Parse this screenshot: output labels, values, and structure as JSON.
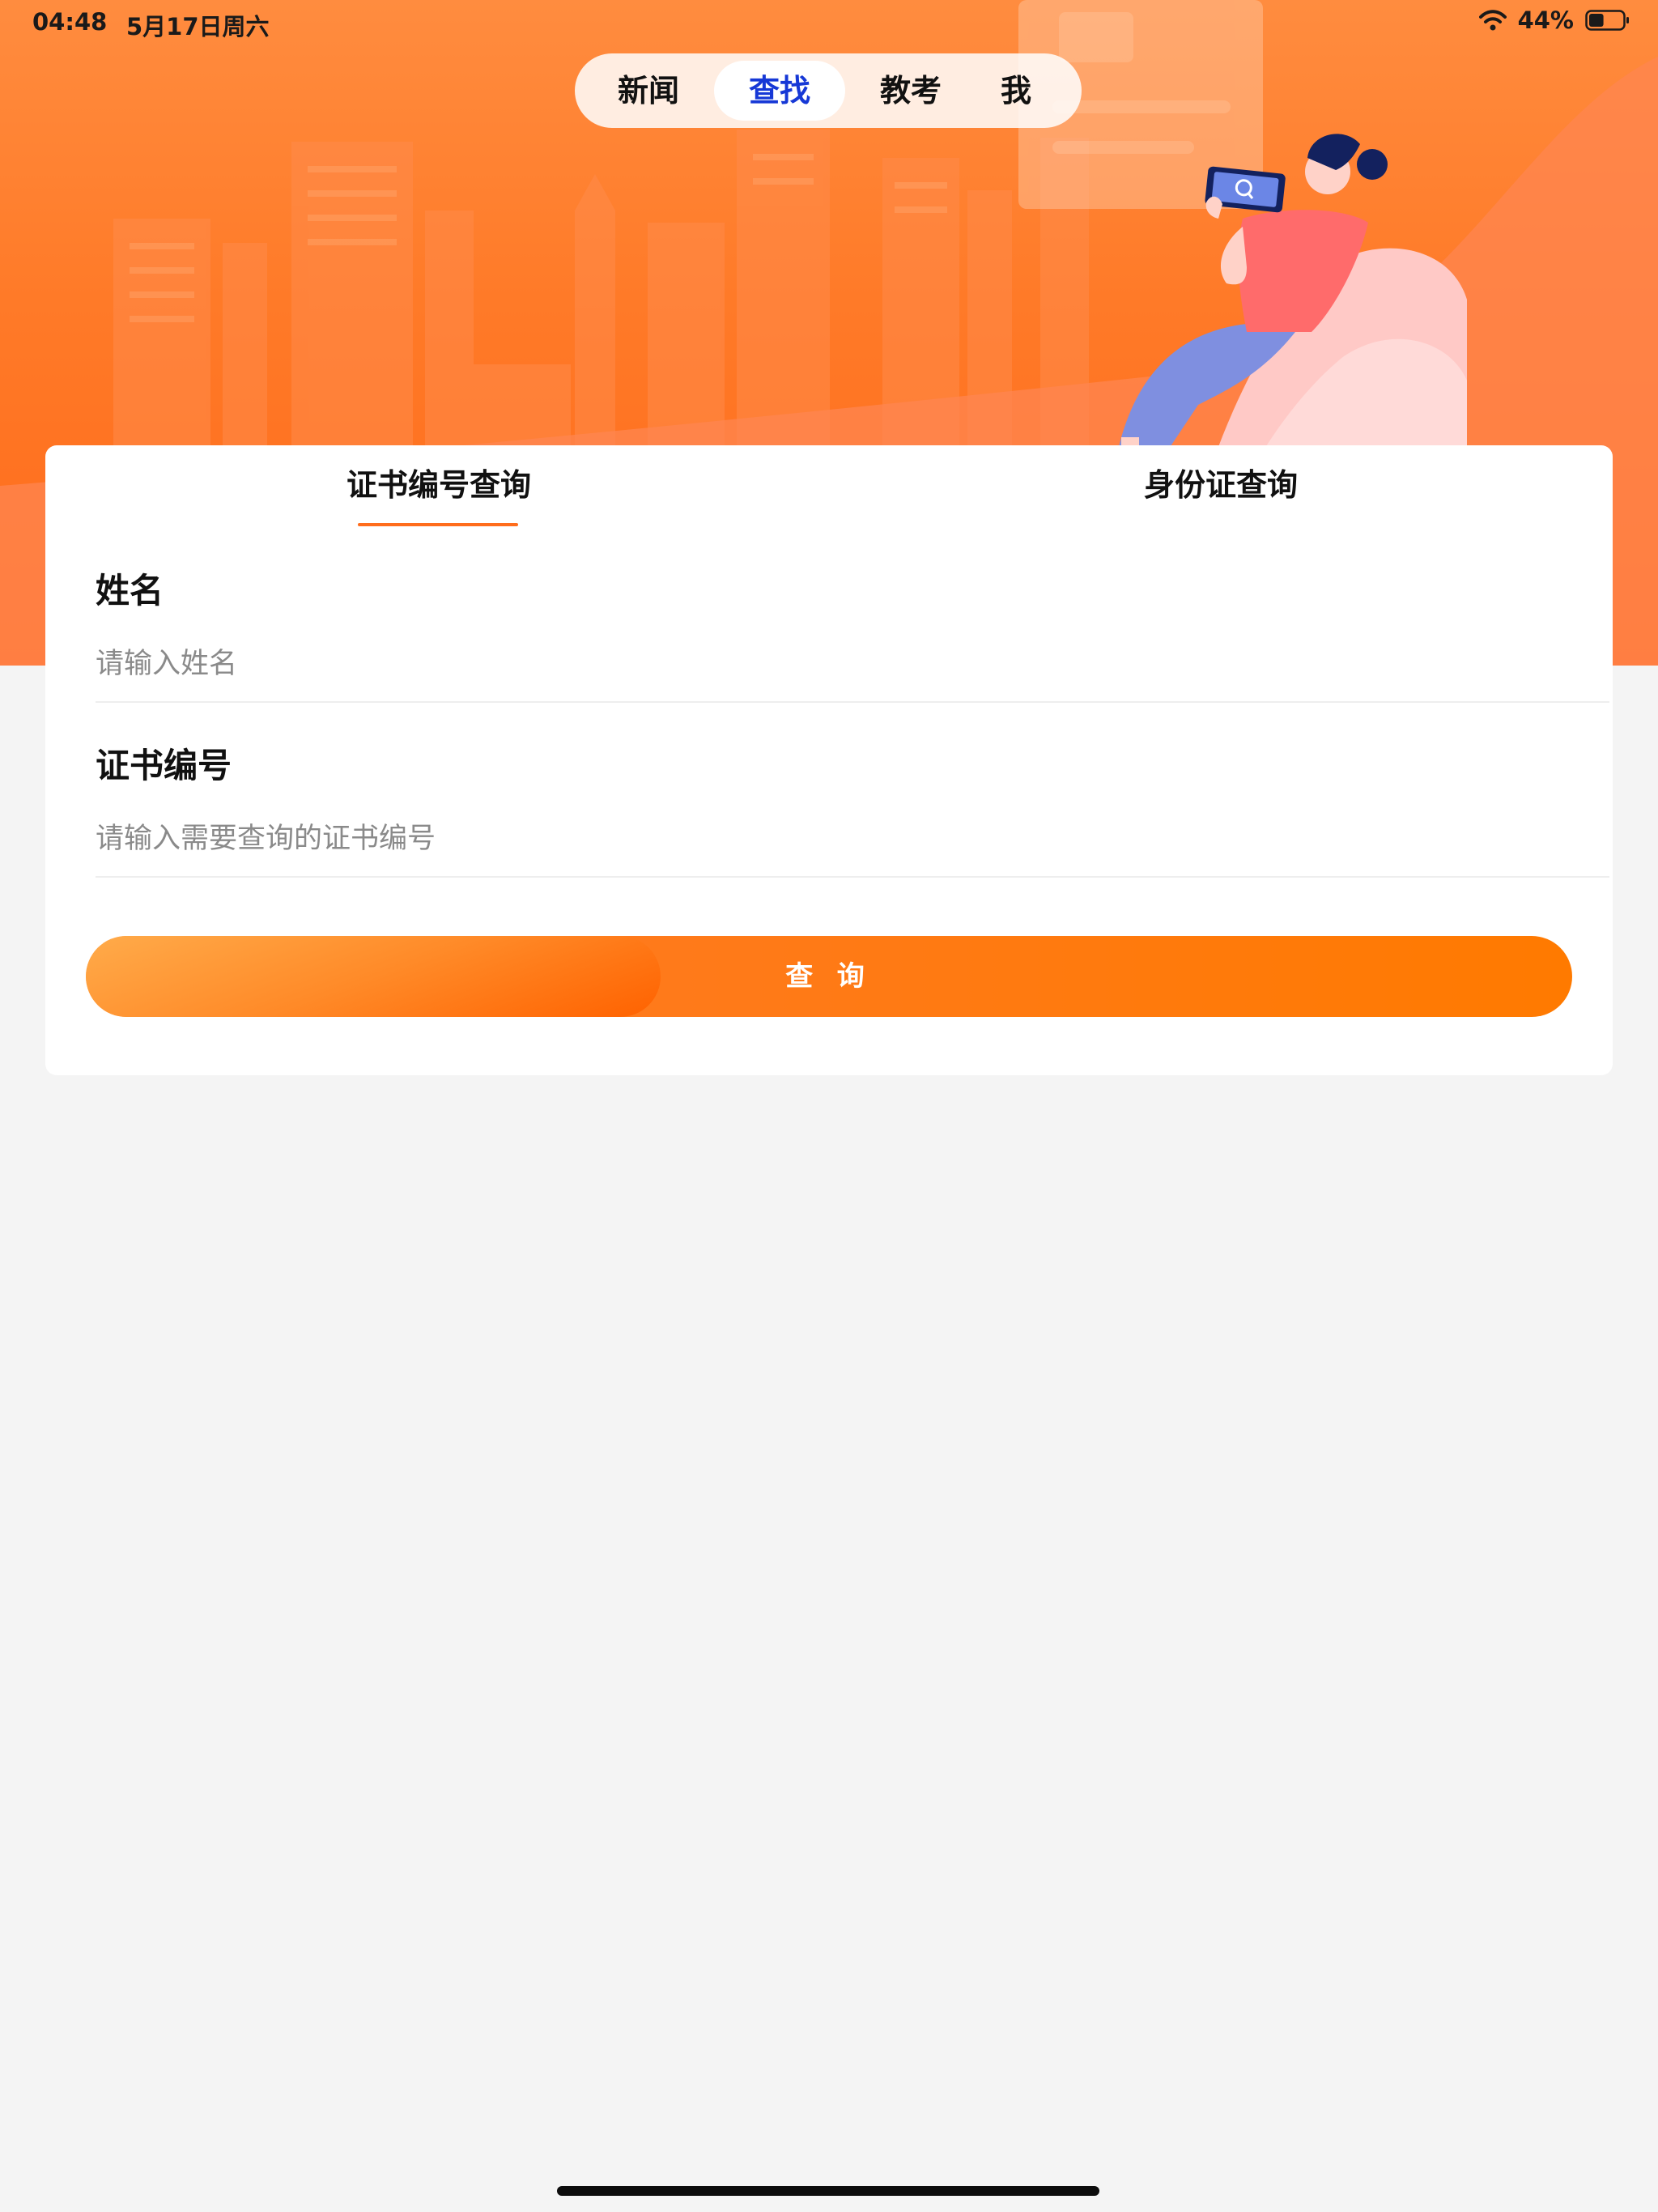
{
  "status_bar": {
    "time": "04:48",
    "date": "5月17日周六",
    "battery_percent": "44%",
    "battery_level": 0.44,
    "icons": [
      "wifi-icon",
      "battery-icon"
    ]
  },
  "nav": {
    "tabs": [
      {
        "label": "新闻",
        "active": false
      },
      {
        "label": "查找",
        "active": true
      },
      {
        "label": "教考",
        "active": false
      },
      {
        "label": "我",
        "active": false
      }
    ]
  },
  "query": {
    "tabs": [
      {
        "label": "证书编号查询",
        "active": true
      },
      {
        "label": "身份证查询",
        "active": false
      }
    ],
    "fields": [
      {
        "label": "姓名",
        "value": "",
        "placeholder": "请输入姓名"
      },
      {
        "label": "证书编号",
        "value": "",
        "placeholder": "请输入需要查询的证书编号"
      }
    ],
    "submit_label": "查 询"
  },
  "colors": {
    "accent": "#ff7a00",
    "active_tab_text": "#1638d6",
    "hero_orange": "#ff7a28",
    "background": "#f4f4f4"
  }
}
